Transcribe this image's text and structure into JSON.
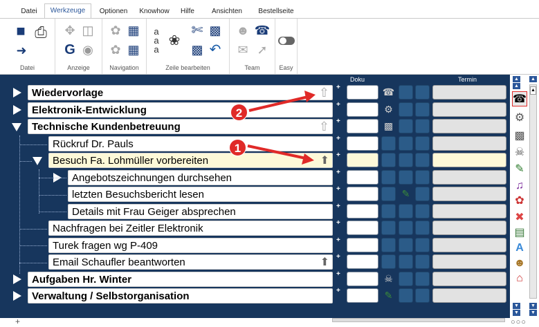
{
  "menu": [
    "Datei",
    "Werkzeuge",
    "Optionen",
    "Knowhow",
    "Hilfe",
    "Ansichten",
    "Bestellseite"
  ],
  "active_menu": "Werkzeuge",
  "ribbon_groups": [
    "Datei",
    "Anzeige",
    "Navigation",
    "Zeile bearbeiten",
    "Team",
    "Easy"
  ],
  "columns": {
    "doku": "Doku",
    "termin": "Termin"
  },
  "rows": [
    {
      "label": "Wiedervorlage",
      "bold": true,
      "level": 0,
      "expander": "right",
      "marker": "outline-arrow"
    },
    {
      "label": "Elektronik-Entwicklung",
      "bold": true,
      "level": 0,
      "expander": "right",
      "marker": ""
    },
    {
      "label": "Technische Kundenbetreuung",
      "bold": true,
      "level": 0,
      "expander": "down",
      "marker": "outline-arrow"
    },
    {
      "label": "Rückruf Dr. Pauls",
      "bold": false,
      "level": 1,
      "expander": "",
      "marker": ""
    },
    {
      "label": "Besuch Fa. Lohmüller vorbereiten",
      "bold": false,
      "level": 1,
      "expander": "down",
      "marker": "solid-arrow",
      "highlight": true
    },
    {
      "label": "Angebotszeichnungen durchsehen",
      "bold": false,
      "level": 2,
      "expander": "right",
      "marker": ""
    },
    {
      "label": "letzten Besuchsbericht lesen",
      "bold": false,
      "level": 2,
      "expander": "",
      "marker": ""
    },
    {
      "label": "Details mit Frau Geiger absprechen",
      "bold": false,
      "level": 2,
      "expander": "",
      "marker": ""
    },
    {
      "label": "Nachfragen bei Zeitler Elektronik",
      "bold": false,
      "level": 1,
      "expander": "",
      "marker": ""
    },
    {
      "label": "Turek fragen wg P-409",
      "bold": false,
      "level": 1,
      "expander": "",
      "marker": ""
    },
    {
      "label": "Email Schaufler beantworten",
      "bold": false,
      "level": 1,
      "expander": "",
      "marker": "solid-arrow"
    },
    {
      "label": "Aufgaben Hr. Winter",
      "bold": true,
      "level": 0,
      "expander": "right",
      "marker": ""
    },
    {
      "label": "Verwaltung / Selbstorganisation",
      "bold": true,
      "level": 0,
      "expander": "right",
      "marker": ""
    }
  ],
  "callouts": [
    "1",
    "2"
  ],
  "status_text": "+",
  "colors": {
    "workarea": "#17365d",
    "accent": "#2b579a",
    "callout": "#e02a28"
  }
}
